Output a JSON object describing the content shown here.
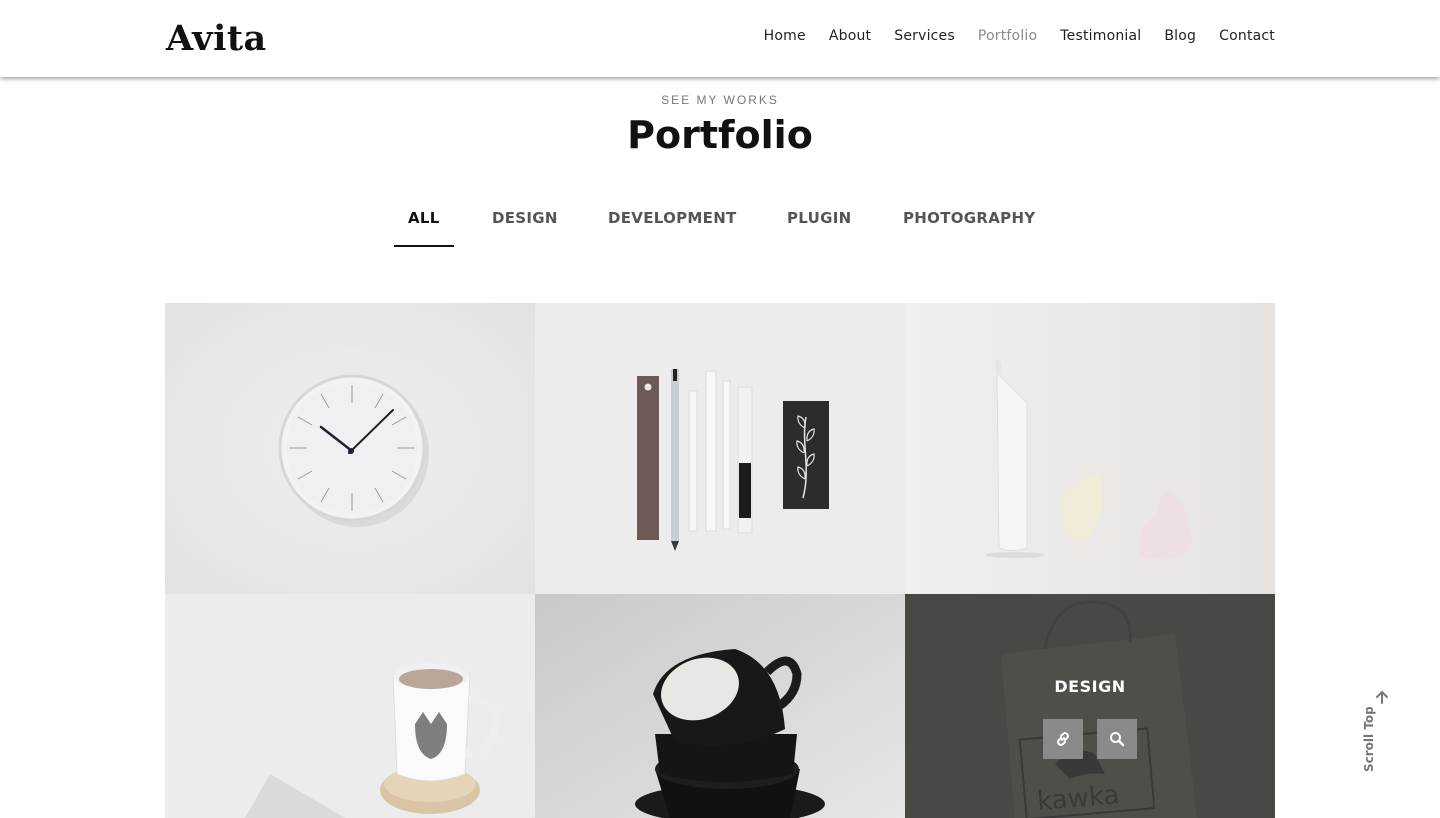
{
  "brand": {
    "logo": "Avita"
  },
  "nav": {
    "items": [
      {
        "label": "Home"
      },
      {
        "label": "About"
      },
      {
        "label": "Services"
      },
      {
        "label": "Portfolio",
        "active": true
      },
      {
        "label": "Testimonial"
      },
      {
        "label": "Blog"
      },
      {
        "label": "Contact"
      }
    ]
  },
  "section": {
    "eyebrow": "SEE MY WORKS",
    "title": "Portfolio"
  },
  "filters": {
    "items": [
      {
        "label": "ALL",
        "active": true
      },
      {
        "label": "DESIGN"
      },
      {
        "label": "DEVELOPMENT"
      },
      {
        "label": "PLUGIN"
      },
      {
        "label": "PHOTOGRAPHY"
      }
    ]
  },
  "portfolio": {
    "items": [
      {
        "subject": "wall clock"
      },
      {
        "subject": "stationery"
      },
      {
        "subject": "ceramic vases"
      },
      {
        "subject": "coffee mug"
      },
      {
        "subject": "black cups"
      },
      {
        "subject": "paper bag",
        "overlay_category": "DESIGN",
        "bag_text": "kawka"
      }
    ],
    "overlay_icons": [
      "link-icon",
      "search-icon"
    ]
  },
  "scroll_top": {
    "label": "Scroll Top"
  },
  "colors": {
    "accent_active_nav": "#8a8a8a",
    "overlay": "#3c3e3c",
    "overlay_button": "#8a8a8a"
  }
}
